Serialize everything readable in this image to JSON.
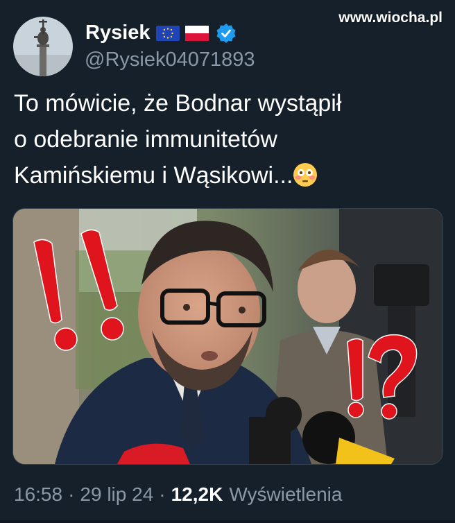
{
  "watermark": "www.wiocha.pl",
  "author": {
    "display_name": "Rysiek",
    "handle": "@Rysiek04071893",
    "flags": [
      "eu-flag-icon",
      "poland-flag-icon"
    ],
    "verified_icon": "verified-badge-icon"
  },
  "tweet": {
    "line1": "To mówicie, że Bodnar wystąpił",
    "line2": "o odebranie immunitetów",
    "line3": "Kamińskiemu i Wąsikowi...",
    "emoji": "flushed-face-emoji"
  },
  "media": {
    "annotations": [
      "!",
      "!",
      "!",
      "?"
    ]
  },
  "meta": {
    "time": "16:58",
    "separator": "·",
    "date": "29 lip 24",
    "views_count": "12,2K",
    "views_label": "Wyświetlenia"
  },
  "colors": {
    "background": "#15202b",
    "secondary_text": "#8b98a5",
    "verified_blue": "#1d9bf0",
    "annotation_red": "#e0141c"
  }
}
